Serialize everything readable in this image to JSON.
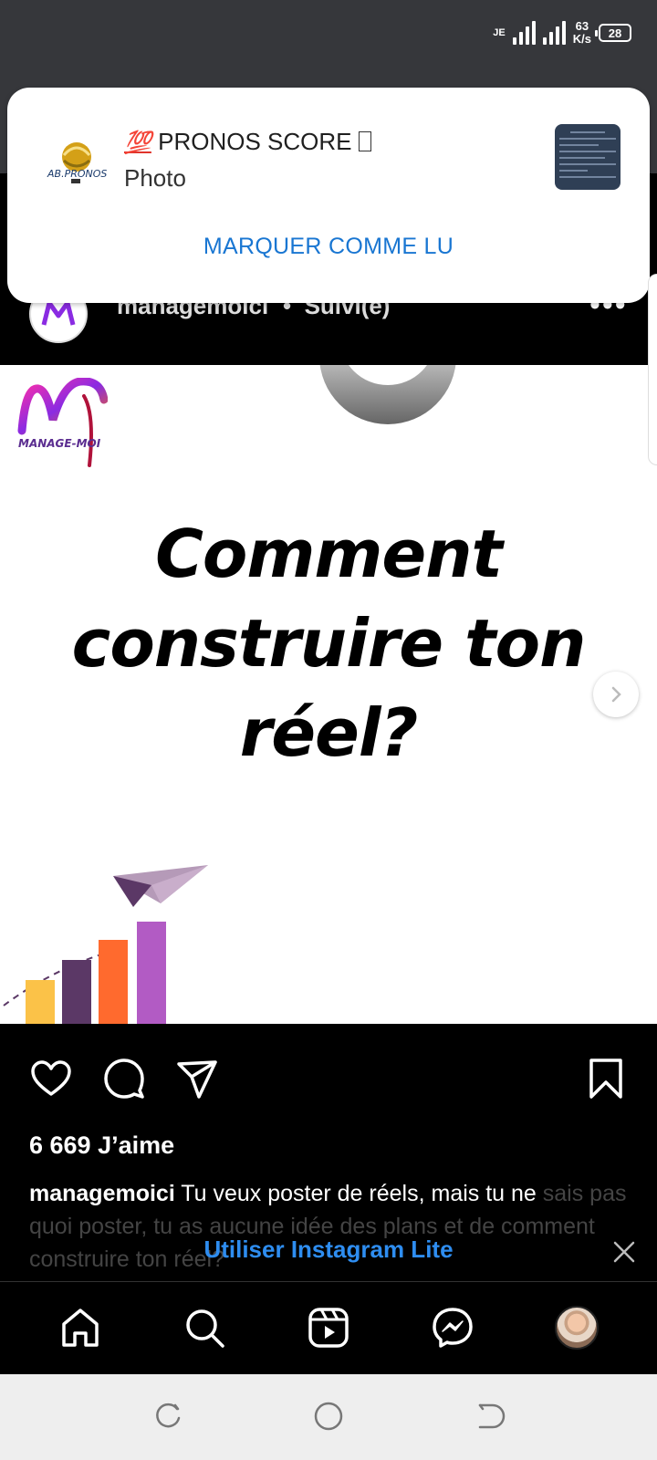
{
  "status_bar": {
    "network_speed_value": "63",
    "network_speed_unit": "K/s",
    "battery": "28",
    "sim_badge": "JE"
  },
  "notification": {
    "app_logo_text": "AB.PRONOS",
    "title_emoji": "💯",
    "title": "PRONOS SCORE",
    "title_suffix": "",
    "subtitle": "Photo",
    "action": "MARQUER COMME LU"
  },
  "post": {
    "username": "managemoici",
    "separator": "•",
    "follow_status": "Suivi(e)",
    "more_icon": "more-horizontal-icon",
    "brand_logo_text": "MANAGE-MOI",
    "headline_lines": [
      "Comment",
      "construire ton",
      "réel?"
    ],
    "likes": "6 669 J’aime",
    "caption_user": "managemoici",
    "caption_text": "Tu veux poster de réels, mais tu ne",
    "caption_faded": "sais pas quoi poster, tu as aucune idée des plans et de comment construire ton réel?"
  },
  "actions": {
    "like_icon": "heart-icon",
    "comment_icon": "comment-icon",
    "share_icon": "send-icon",
    "save_icon": "bookmark-icon"
  },
  "lite_banner": {
    "label": "Utiliser Instagram Lite"
  },
  "bottom_nav": [
    "home-icon",
    "search-icon",
    "reels-icon",
    "messenger-icon",
    "profile-avatar"
  ],
  "colors": {
    "accent_blue": "#1976d2",
    "lite_blue": "#2e8df0",
    "status_bar_bg": "#36373b",
    "chart_yellow": "#fbc248",
    "chart_purple_dark": "#5b3866",
    "chart_orange": "#ff6a2e",
    "chart_purple": "#b25bc4"
  }
}
